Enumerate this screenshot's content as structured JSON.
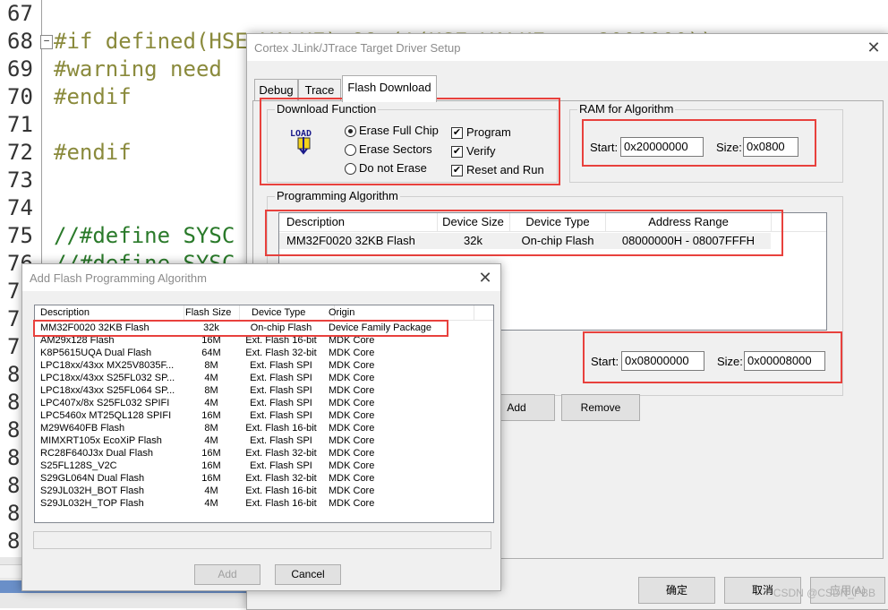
{
  "editor": {
    "lines": [
      {
        "num": "67",
        "text": ""
      },
      {
        "num": "68",
        "text": "#if defined(HSE_VALUE) && (!(HSE_VALUE == 8000000))"
      },
      {
        "num": "69",
        "text": "#warning need"
      },
      {
        "num": "70",
        "text": "#endif"
      },
      {
        "num": "71",
        "text": ""
      },
      {
        "num": "72",
        "text": "#endif"
      },
      {
        "num": "73",
        "text": ""
      },
      {
        "num": "74",
        "text": ""
      },
      {
        "num": "75",
        "text": "//#define SYSC"
      },
      {
        "num": "76",
        "text": "//#define SYSC"
      },
      {
        "num": "7",
        "text": ""
      },
      {
        "num": "7",
        "text": ""
      },
      {
        "num": "7",
        "text": ""
      },
      {
        "num": "8",
        "text": ""
      },
      {
        "num": "8",
        "text": ""
      },
      {
        "num": "8",
        "text": ""
      },
      {
        "num": "8",
        "text": ""
      },
      {
        "num": "8",
        "text": ""
      },
      {
        "num": "8",
        "text": ""
      },
      {
        "num": "8",
        "text": ""
      }
    ],
    "fold_symbol": "−"
  },
  "target_dialog": {
    "title": "Cortex JLink/JTrace Target Driver Setup",
    "close_symbol": "✕",
    "tabs": [
      {
        "label": "Debug"
      },
      {
        "label": "Trace"
      },
      {
        "label": "Flash Download"
      }
    ],
    "download_function": {
      "label": "Download Function",
      "icon_text": "LOAD",
      "radios": [
        {
          "label": "Erase Full Chip",
          "checked": true
        },
        {
          "label": "Erase Sectors",
          "checked": false
        },
        {
          "label": "Do not Erase",
          "checked": false
        }
      ],
      "checks": [
        {
          "label": "Program",
          "checked": true
        },
        {
          "label": "Verify",
          "checked": true
        },
        {
          "label": "Reset and Run",
          "checked": true
        }
      ],
      "check_mark": "✔"
    },
    "ram": {
      "label": "RAM for Algorithm",
      "start_label": "Start:",
      "start_value": "0x20000000",
      "size_label": "Size:",
      "size_value": "0x0800"
    },
    "prog_algo": {
      "label": "Programming Algorithm",
      "columns": [
        "Description",
        "Device Size",
        "Device Type",
        "Address Range"
      ],
      "rows": [
        [
          "MM32F0020 32KB Flash",
          "32k",
          "On-chip Flash",
          "08000000H - 08007FFFH"
        ]
      ],
      "start_label": "Start:",
      "start_value": "0x08000000",
      "size_label": "Size:",
      "size_value": "0x00008000",
      "add_label": "Add",
      "remove_label": "Remove"
    },
    "ok_label": "确定",
    "cancel_label": "取消",
    "apply_label": "应用(A)"
  },
  "add_dialog": {
    "title": "Add Flash Programming Algorithm",
    "close_symbol": "✕",
    "columns": [
      "Description",
      "Flash Size",
      "Device Type",
      "Origin"
    ],
    "rows": [
      [
        "MM32F0020 32KB Flash",
        "32k",
        "On-chip Flash",
        "Device Family Package"
      ],
      [
        "AM29x128 Flash",
        "16M",
        "Ext. Flash 16-bit",
        "MDK Core"
      ],
      [
        "K8P5615UQA Dual Flash",
        "64M",
        "Ext. Flash 32-bit",
        "MDK Core"
      ],
      [
        "LPC18xx/43xx MX25V8035F...",
        "8M",
        "Ext. Flash SPI",
        "MDK Core"
      ],
      [
        "LPC18xx/43xx S25FL032 SP...",
        "4M",
        "Ext. Flash SPI",
        "MDK Core"
      ],
      [
        "LPC18xx/43xx S25FL064 SP...",
        "8M",
        "Ext. Flash SPI",
        "MDK Core"
      ],
      [
        "LPC407x/8x S25FL032 SPIFI",
        "4M",
        "Ext. Flash SPI",
        "MDK Core"
      ],
      [
        "LPC5460x MT25QL128 SPIFI",
        "16M",
        "Ext. Flash SPI",
        "MDK Core"
      ],
      [
        "M29W640FB Flash",
        "8M",
        "Ext. Flash 16-bit",
        "MDK Core"
      ],
      [
        "MIMXRT105x EcoXiP Flash",
        "4M",
        "Ext. Flash SPI",
        "MDK Core"
      ],
      [
        "RC28F640J3x Dual Flash",
        "16M",
        "Ext. Flash 32-bit",
        "MDK Core"
      ],
      [
        "S25FL128S_V2C",
        "16M",
        "Ext. Flash SPI",
        "MDK Core"
      ],
      [
        "S29GL064N Dual Flash",
        "16M",
        "Ext. Flash 32-bit",
        "MDK Core"
      ],
      [
        "S29JL032H_BOT Flash",
        "4M",
        "Ext. Flash 16-bit",
        "MDK Core"
      ],
      [
        "S29JL032H_TOP Flash",
        "4M",
        "Ext. Flash 16-bit",
        "MDK Core"
      ]
    ],
    "add_label": "Add",
    "cancel_label": "Cancel"
  },
  "watermark": "CSDN @CSDN_PBB",
  "colors": {
    "highlight_red": "#e8413d",
    "dialog_bg": "#f0f0f0",
    "list_selected": "#f0f0f0"
  }
}
